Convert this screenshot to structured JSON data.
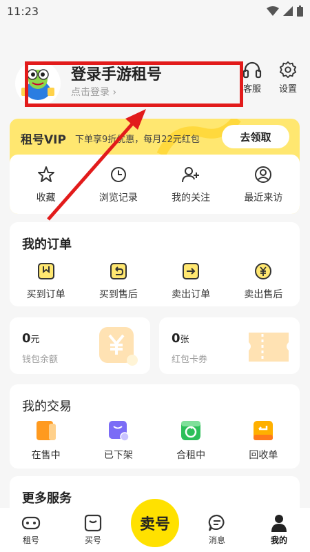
{
  "status_bar": {
    "time": "11:23"
  },
  "profile": {
    "title": "登录手游租号",
    "subtitle": "点击登录 ›",
    "service_label": "客服",
    "settings_label": "设置"
  },
  "vip": {
    "title": "租号VIP",
    "desc": "下单享9折优惠，每月22元红包",
    "button": "去领取",
    "menu": [
      {
        "icon": "star-icon",
        "label": "收藏"
      },
      {
        "icon": "clock-icon",
        "label": "浏览记录"
      },
      {
        "icon": "add-user-icon",
        "label": "我的关注"
      },
      {
        "icon": "visitor-icon",
        "label": "最近来访"
      }
    ]
  },
  "orders": {
    "title": "我的订单",
    "items": [
      {
        "icon": "bookmark-box-icon",
        "label": "买到订单"
      },
      {
        "icon": "return-box-icon",
        "label": "买到售后"
      },
      {
        "icon": "arrow-box-icon",
        "label": "卖出订单"
      },
      {
        "icon": "yen-circle-icon",
        "label": "卖出售后"
      }
    ]
  },
  "wallet": {
    "balance_amount": "0",
    "balance_unit": "元",
    "balance_label": "钱包余额",
    "coupon_amount": "0",
    "coupon_unit": "张",
    "coupon_label": "红包卡券"
  },
  "trades": {
    "title": "我的交易",
    "items": [
      {
        "icon": "on-sale-icon",
        "label": "在售中",
        "color": "#ff9a1f"
      },
      {
        "icon": "off-shelf-icon",
        "label": "已下架",
        "color": "#7b6cf6"
      },
      {
        "icon": "co-rent-icon",
        "label": "合租中",
        "color": "#2dbf5a"
      },
      {
        "icon": "recycle-icon",
        "label": "回收单",
        "color": "#ffb000"
      }
    ]
  },
  "more": {
    "title": "更多服务"
  },
  "bottom_nav": {
    "items": [
      "租号",
      "买号",
      "卖号",
      "消息",
      "我的"
    ]
  },
  "colors": {
    "accent": "#ffe100",
    "highlight": "#e21b1b"
  }
}
